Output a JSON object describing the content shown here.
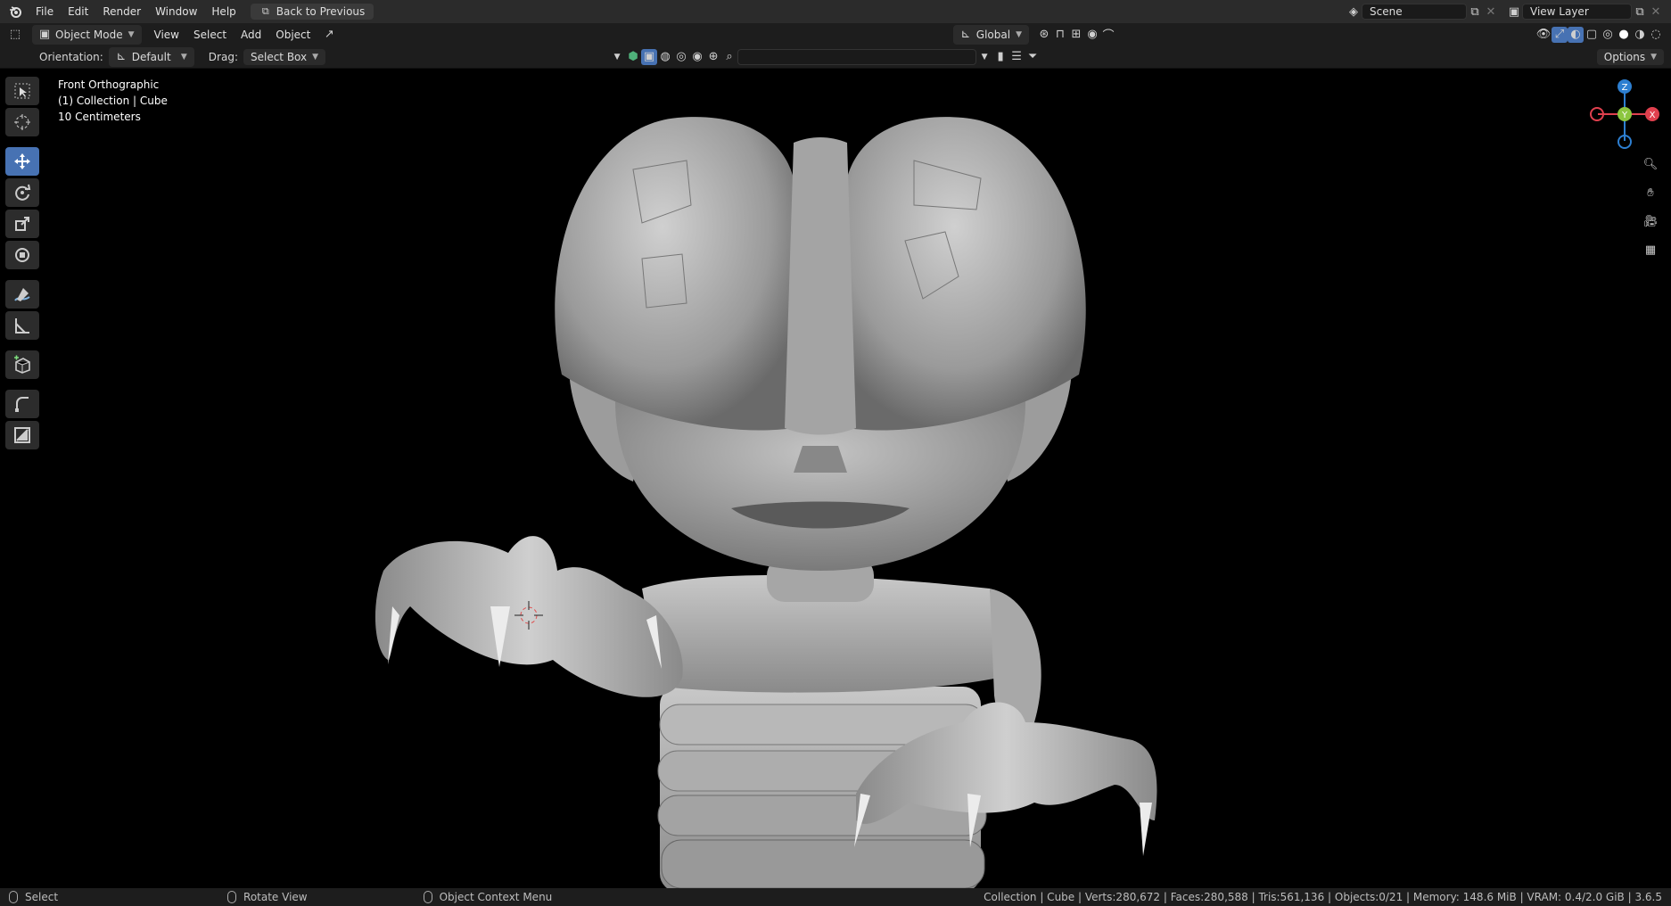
{
  "topbar": {
    "menus": [
      "File",
      "Edit",
      "Render",
      "Window",
      "Help"
    ],
    "back_button": "Back to Previous",
    "scene_label": "Scene",
    "view_layer_label": "View Layer"
  },
  "header": {
    "mode": "Object Mode",
    "menus": [
      "View",
      "Select",
      "Add",
      "Object"
    ],
    "transform_orientation": "Global"
  },
  "tool_settings": {
    "orientation_label": "Orientation:",
    "orientation_value": "Default",
    "drag_label": "Drag:",
    "drag_value": "Select Box",
    "options_label": "Options",
    "search_placeholder": ""
  },
  "viewport": {
    "view_name": "Front Orthographic",
    "collection_info": "(1) Collection | Cube",
    "scale_info": "10 Centimeters",
    "gizmo_axes": {
      "x": "X",
      "y": "Y",
      "z": "Z"
    },
    "gizmo_colors": {
      "x": "#e0404e",
      "y": "#8cc63f",
      "z": "#2d7fd1"
    }
  },
  "toolbar": {
    "tools": [
      "select-box",
      "cursor",
      "move",
      "rotate",
      "scale",
      "transform",
      "annotate",
      "measure",
      "add-cube",
      "shear",
      "sculpt-box"
    ],
    "active_tool": "move",
    "accent_color": "#4772b3"
  },
  "status": {
    "left_action": "Select",
    "middle_action": "Rotate View",
    "right_action": "Object Context Menu",
    "stats": "Collection | Cube | Verts:280,672 | Faces:280,588 | Tris:561,136 | Objects:0/21 | Memory: 148.6 MiB | VRAM: 0.4/2.0 GiB | 3.6.5"
  }
}
